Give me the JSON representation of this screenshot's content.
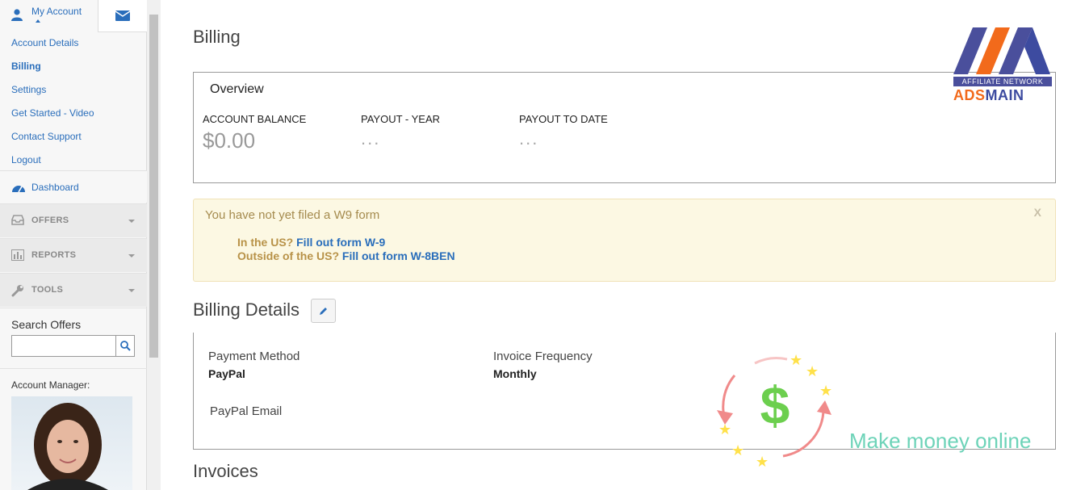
{
  "sidebar": {
    "account_tab_label": "My Account",
    "account_items": [
      "Account Details",
      "Billing",
      "Settings",
      "Get Started - Video",
      "Contact Support",
      "Logout"
    ],
    "active_item": "Billing",
    "dashboard_label": "Dashboard",
    "nav": [
      {
        "label": "OFFERS"
      },
      {
        "label": "REPORTS"
      },
      {
        "label": "TOOLS"
      }
    ],
    "search_label": "Search Offers",
    "search_value": "",
    "account_manager_label": "Account Manager:"
  },
  "main": {
    "title": "Billing",
    "overview": {
      "heading": "Overview",
      "balance_label": "ACCOUNT BALANCE",
      "balance_value": "$0.00",
      "payout_year_label": "PAYOUT - YEAR",
      "payout_year_value": "...",
      "payout_date_label": "PAYOUT TO DATE",
      "payout_date_value": "..."
    },
    "w9_alert": {
      "message": "You have not yet filed a W9 form",
      "close": "X",
      "us_prefix": "In the US?",
      "us_link": "Fill out form W-9",
      "outside_prefix": "Outside of the US?",
      "outside_link": "Fill out form W-8BEN"
    },
    "billing_details": {
      "title": "Billing Details",
      "payment_method_label": "Payment Method",
      "payment_method_value": "PayPal",
      "invoice_frequency_label": "Invoice Frequency",
      "invoice_frequency_value": "Monthly",
      "paypal_email_label": "PayPal Email"
    },
    "invoices_title": "Invoices"
  },
  "overlay": {
    "logo_band": "AFFILIATE NETWORK",
    "logo_brand_a": "ADS",
    "logo_brand_b": "MAIN",
    "tagline": "Make money online"
  },
  "colors": {
    "link": "#2a6ebb",
    "alert_bg": "#fcf8e3",
    "alert_text": "#a58b4e",
    "logo_orange": "#f26a1b",
    "logo_blue": "#3d4ba0",
    "tagline": "#6dd3b8"
  }
}
